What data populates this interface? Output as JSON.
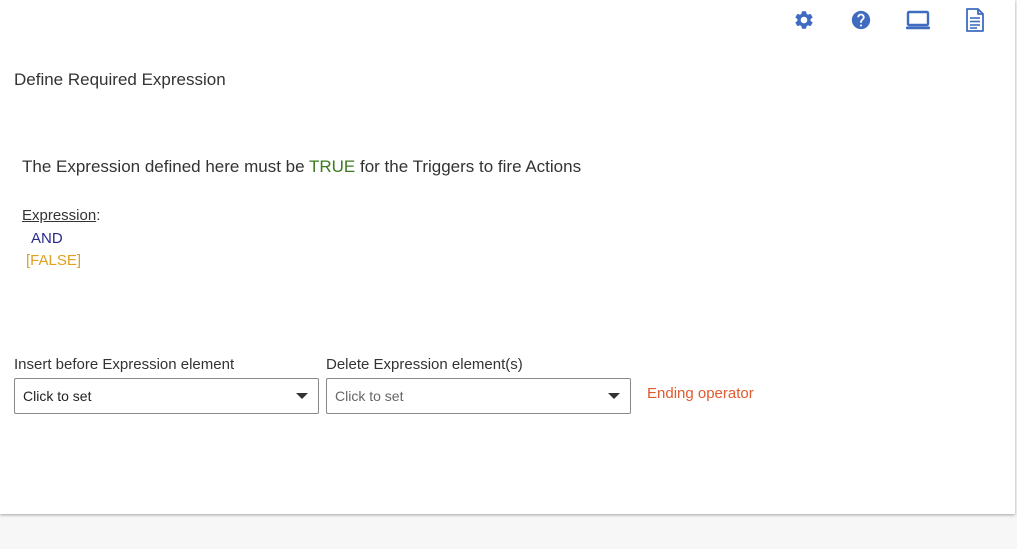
{
  "toolbar": {
    "icons": [
      "gear-icon",
      "help-icon",
      "laptop-icon",
      "document-icon"
    ],
    "icon_color": "#3f6cc0"
  },
  "page": {
    "title": "Define Required Expression"
  },
  "description": {
    "prefix": "The Expression defined here must be ",
    "highlight": "TRUE",
    "suffix": " for the Triggers to fire Actions",
    "highlight_color": "#3c7a1f"
  },
  "expression": {
    "label": "Expression",
    "colon": ":",
    "operator": "AND",
    "operator_color": "#2a2a8e",
    "value": "[FALSE]",
    "value_color": "#e0a020"
  },
  "insert_field": {
    "label": "Insert before Expression element",
    "value": "Click to set"
  },
  "delete_field": {
    "label": "Delete Expression element(s)",
    "value": "Click to set"
  },
  "warning": {
    "text": "Ending operator",
    "color": "#e05a2e"
  }
}
